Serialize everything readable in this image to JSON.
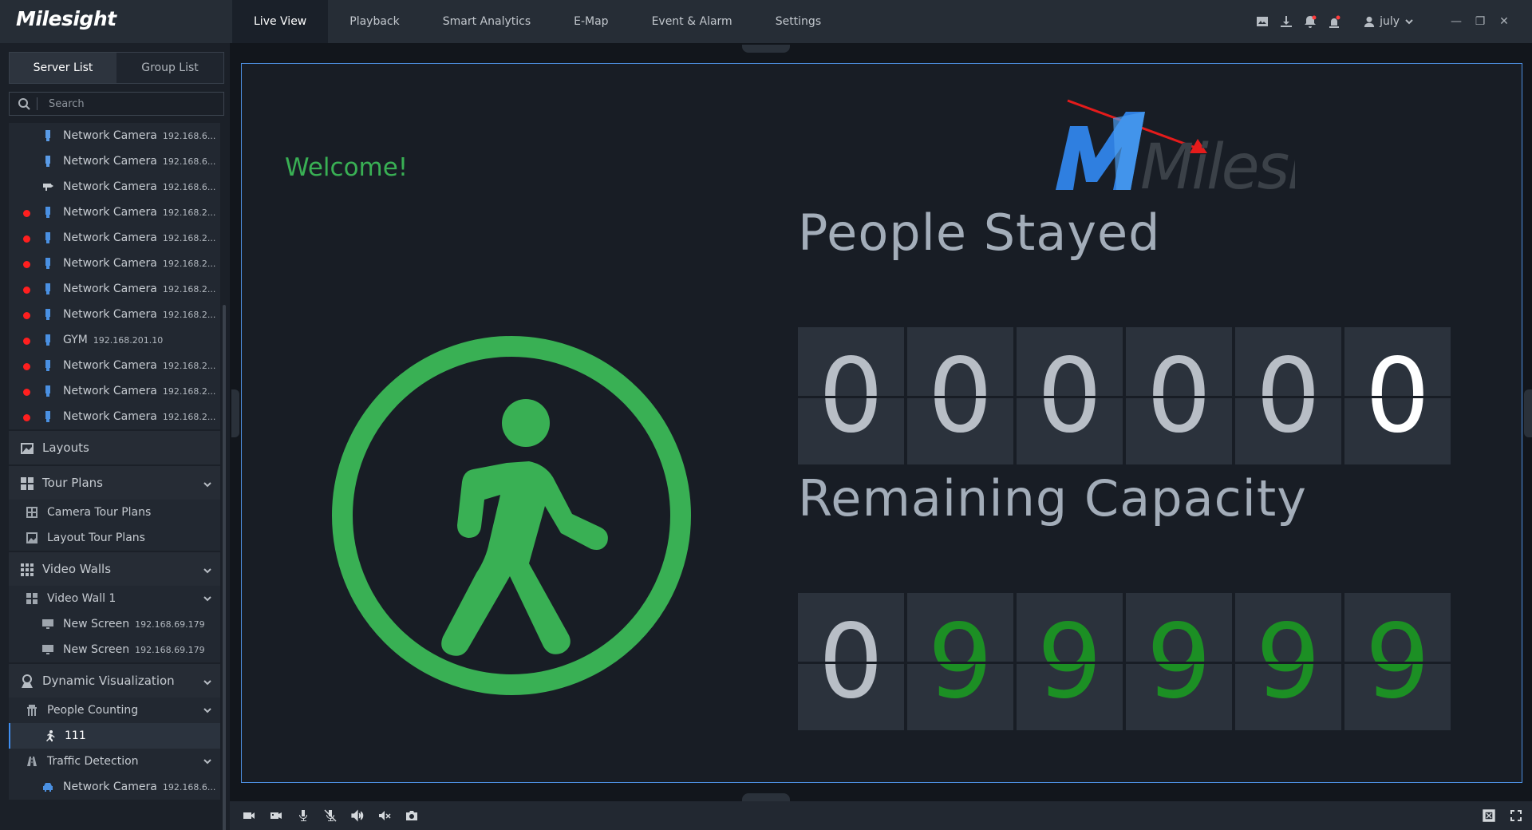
{
  "app": {
    "brand": "Milesight"
  },
  "nav": {
    "tabs": [
      "Live View",
      "Playback",
      "Smart Analytics",
      "E-Map",
      "Event & Alarm",
      "Settings"
    ],
    "active": "Live View"
  },
  "user": {
    "name": "july"
  },
  "sidebar": {
    "tabs": [
      "Server List",
      "Group List"
    ],
    "search_placeholder": "Search",
    "cameras": [
      {
        "name": "Network Camera",
        "ip": "192.168.6...",
        "alarm": false,
        "icon": "bullet-camera-icon"
      },
      {
        "name": "Network Camera",
        "ip": "192.168.6...",
        "alarm": false,
        "icon": "bullet-camera-icon"
      },
      {
        "name": "Network Camera",
        "ip": "192.168.6...",
        "alarm": false,
        "icon": "box-camera-icon"
      },
      {
        "name": "Network Camera",
        "ip": "192.168.2...",
        "alarm": true,
        "icon": "bullet-camera-icon"
      },
      {
        "name": "Network Camera",
        "ip": "192.168.2...",
        "alarm": true,
        "icon": "bullet-camera-icon"
      },
      {
        "name": "Network Camera",
        "ip": "192.168.2...",
        "alarm": true,
        "icon": "bullet-camera-icon"
      },
      {
        "name": "Network Camera",
        "ip": "192.168.2...",
        "alarm": true,
        "icon": "bullet-camera-icon"
      },
      {
        "name": "Network Camera",
        "ip": "192.168.2...",
        "alarm": true,
        "icon": "bullet-camera-icon"
      },
      {
        "name": "GYM",
        "ip": "192.168.201.10",
        "alarm": true,
        "icon": "bullet-camera-icon"
      },
      {
        "name": "Network Camera",
        "ip": "192.168.2...",
        "alarm": true,
        "icon": "bullet-camera-icon"
      },
      {
        "name": "Network Camera",
        "ip": "192.168.2...",
        "alarm": true,
        "icon": "bullet-camera-icon"
      },
      {
        "name": "Network Camera",
        "ip": "192.168.2...",
        "alarm": true,
        "icon": "bullet-camera-icon"
      }
    ],
    "layouts": "Layouts",
    "tour_plans": {
      "label": "Tour Plans",
      "items": [
        "Camera Tour Plans",
        "Layout Tour Plans"
      ]
    },
    "video_walls": {
      "label": "Video Walls",
      "wall": "Video Wall 1",
      "screens": [
        {
          "name": "New Screen",
          "ip": "192.168.69.179"
        },
        {
          "name": "New Screen",
          "ip": "192.168.69.179"
        }
      ]
    },
    "dynamic": {
      "label": "Dynamic Visualization",
      "people_counting": "People Counting",
      "selected_item": "111",
      "traffic_detection": "Traffic Detection",
      "traffic_camera": {
        "name": "Network Camera",
        "ip": "192.168.6..."
      }
    }
  },
  "view": {
    "welcome": "Welcome!",
    "logo_text": "Milesight",
    "people_stayed_label": "People Stayed",
    "people_stayed_digits": [
      "0",
      "0",
      "0",
      "0",
      "0",
      "0"
    ],
    "remaining_capacity_label": "Remaining Capacity",
    "remaining_capacity_digits": [
      "0",
      "9",
      "9",
      "9",
      "9",
      "9"
    ]
  },
  "colors": {
    "accent_green": "#39b054",
    "digit_green": "#1c8f24",
    "alarm_red": "#ff1f1f",
    "brand_blue": "#2f7fe0",
    "arrow_red": "#e51b1b"
  }
}
